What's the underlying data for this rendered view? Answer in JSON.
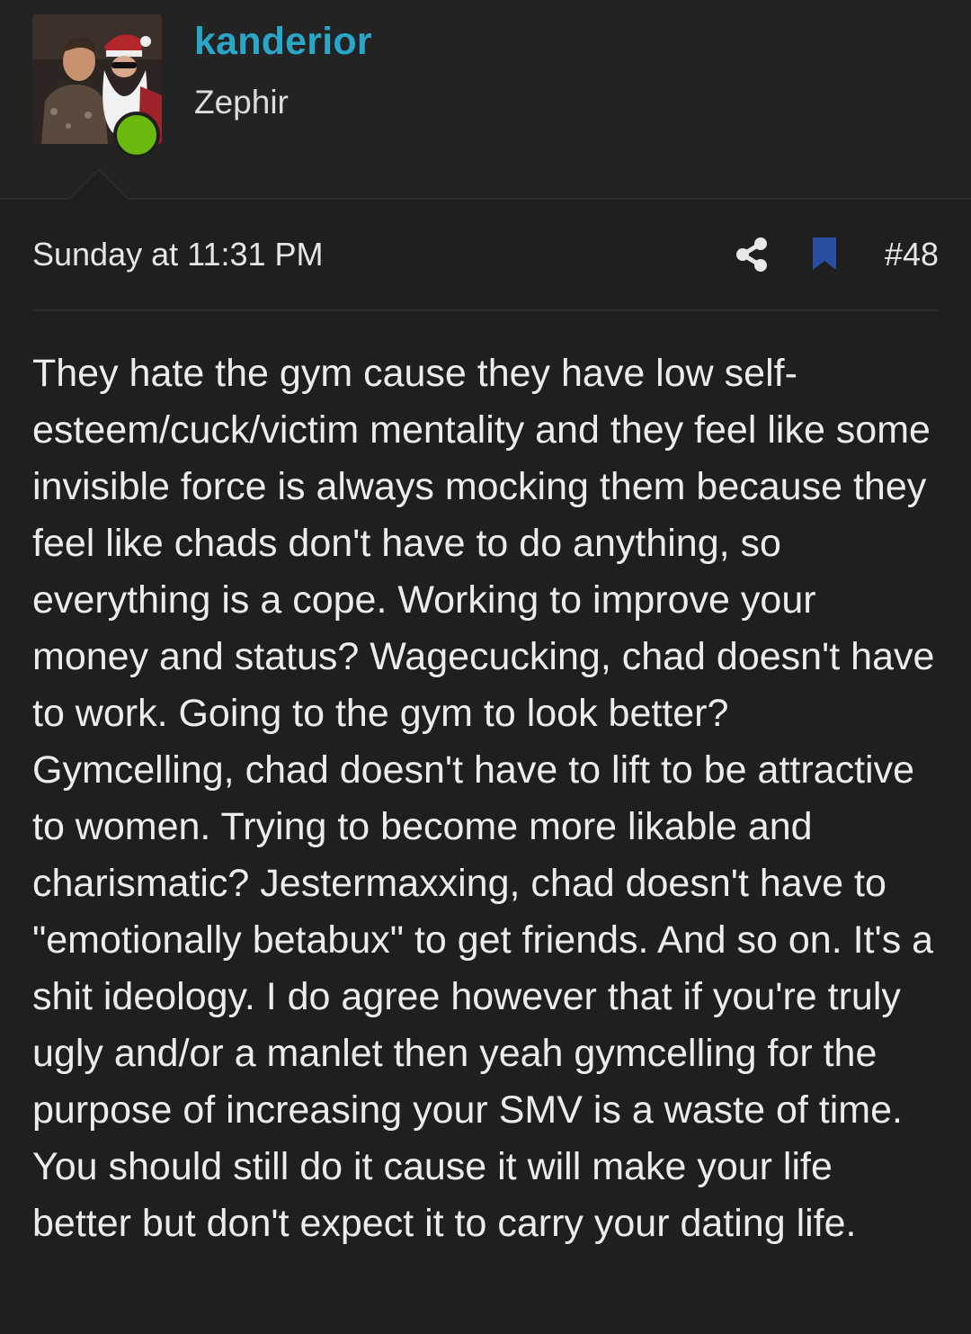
{
  "post": {
    "author": {
      "username": "kanderior",
      "user_title": "Zephir",
      "avatar_icon": "avatar-photo",
      "status": "online",
      "username_color": "#2aa6c8",
      "status_color": "#6bb80f"
    },
    "meta": {
      "date": "Sunday at 11:31 PM",
      "share_icon": "share-icon",
      "bookmark_icon": "bookmark-icon",
      "bookmark_color": "#2b4fa0",
      "post_number": "#48"
    },
    "body": "They hate the gym cause they have low self-esteem/cuck/victim mentality and they feel like some invisible force is always mocking them because they feel like chads don't have to do anything, so everything is a cope. Working to improve your money and status? Wagecucking, chad doesn't have to work. Going to the gym to look better? Gymcelling, chad doesn't have to lift to be attractive to women. Trying to become more likable and charismatic? Jestermaxxing, chad doesn't have to \"emotionally betabux\" to get friends. And so on. It's a shit ideology. I do agree however that if you're truly ugly and/or a manlet then yeah gymcelling for the purpose of increasing your SMV is a waste of time. You should still do it cause it will make your life better but don't expect it to carry your dating life."
  }
}
